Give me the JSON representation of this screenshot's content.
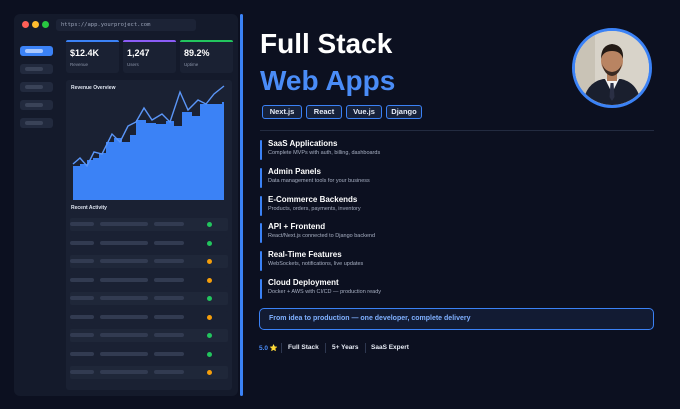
{
  "browser": {
    "url": "https://app.yourproject.com",
    "traffic_light_colors": [
      "#ff5f57",
      "#febc2e",
      "#28c840"
    ]
  },
  "dashboard": {
    "stats": [
      {
        "value": "$12.4K",
        "label": "Revenue",
        "accent": "#3b82f6"
      },
      {
        "value": "1,247",
        "label": "Users",
        "accent": "#8b5cf6"
      },
      {
        "value": "89.2%",
        "label": "Uptime",
        "accent": "#22c55e"
      }
    ],
    "revenue_title": "Revenue Overview",
    "activity_title": "Recent Activity",
    "activity_statuses": [
      "green",
      "green",
      "orange",
      "orange",
      "green",
      "orange",
      "green",
      "green",
      "orange"
    ]
  },
  "hero": {
    "title_line1": "Full Stack",
    "title_line2": "Web Apps",
    "accent_color": "#4a8cf7"
  },
  "tech_tags": [
    "Next.js",
    "React",
    "Vue.js",
    "Django"
  ],
  "features": [
    {
      "title": "SaaS Applications",
      "desc": "Complete MVPs with auth, billing, dashboards"
    },
    {
      "title": "Admin Panels",
      "desc": "Data management tools for your business"
    },
    {
      "title": "E-Commerce Backends",
      "desc": "Products, orders, payments, inventory"
    },
    {
      "title": "API + Frontend",
      "desc": "React/Next.js connected to Django backend"
    },
    {
      "title": "Real-Time Features",
      "desc": "WebSockets, notifications, live updates"
    },
    {
      "title": "Cloud Deployment",
      "desc": "Docker + AWS with CI/CD — production ready"
    }
  ],
  "banner": "From idea to production — one developer, complete delivery",
  "footer_stats": [
    {
      "text": "5.0 ⭐",
      "color": "#4a8cf7"
    },
    {
      "text": "Full Stack",
      "color": "#e6ecf7"
    },
    {
      "text": "5+ Years",
      "color": "#e6ecf7"
    },
    {
      "text": "SaaS Expert",
      "color": "#e6ecf7"
    }
  ]
}
